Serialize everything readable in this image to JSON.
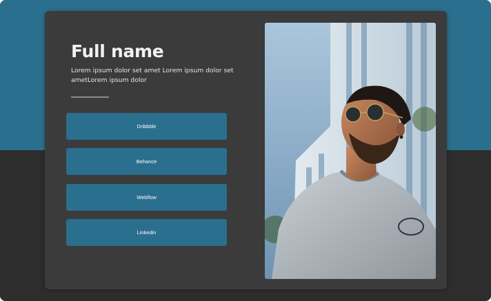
{
  "profile": {
    "name": "Full name",
    "bio": "Lorem ipsum dolor set amet Lorem ipsum dolor set ametLorem ipsum dolor",
    "links": [
      {
        "label": "Dribbble"
      },
      {
        "label": "Behance"
      },
      {
        "label": "Webflow"
      },
      {
        "label": "Linkedin"
      }
    ],
    "photo": {
      "alt": "Bearded man wearing sunglasses and a grey t-shirt in front of a building"
    }
  },
  "colors": {
    "accent": "#2b6f8e",
    "card": "#3b3b3b",
    "background_dark": "#2d2d2d"
  }
}
